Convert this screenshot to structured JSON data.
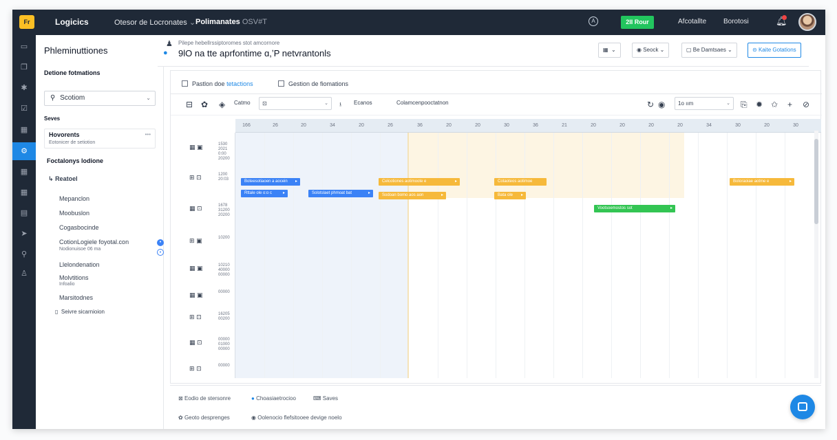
{
  "topbar": {
    "logo": "Fr",
    "brand": "Logicics",
    "menu1": "Otesor de Locronates",
    "menu2": "Polimanates",
    "menu2_sub": "OSV#T",
    "green_button": "2II Rour",
    "link1": "Afcotallte",
    "link2": "Borotosi"
  },
  "sidebar": {
    "title": "Phleminuttiones",
    "section1": "Detione fotmations",
    "select_value": "Scotiom",
    "section2": "Seves",
    "card_title": "Hovorents",
    "card_sub": "Eotonicer de setiotion",
    "section3": "Foctalonys lodione",
    "group": "Reatoel",
    "items": [
      {
        "label": "Mepanclon"
      },
      {
        "label": "Moobuslon"
      },
      {
        "label": "Cogasbocinde"
      },
      {
        "label": "CotionLogiele foyotal.con",
        "sub": "Nodionuisoe 06 ma"
      },
      {
        "label": "Llelondenation"
      },
      {
        "label": "Molvtitions",
        "sub": "Infoalio"
      },
      {
        "label": "Marsitodnes"
      }
    ],
    "footer_item": "Seivre sicarnioion"
  },
  "header": {
    "breadcrumb": "Pilepe hebellrssiptoromes stot amcornore",
    "title": "9lO na tte aprfontime ɑ,ʼP netvrantonls",
    "btn1": "Seock",
    "btn2": "Be Damtsaes",
    "btn_primary": "Kaite Gotations"
  },
  "panel": {
    "tab1_prefix": "Pastlon doe",
    "tab1_highlight": "tetactions",
    "tab2": "Gestion de fiomations",
    "tool_label1": "Catmo",
    "tool_label2": "Ecanos",
    "tool_label3": "Colamcenpooctatnon",
    "zoom_value": "1o ıım"
  },
  "timeline": {
    "dates": [
      "166",
      "26",
      "20",
      "34",
      "20",
      "26",
      "36",
      "20",
      "20",
      "30",
      "36",
      "21",
      "20",
      "20",
      "20",
      "20",
      "34",
      "30",
      "20",
      "30"
    ],
    "rows": [
      {
        "date": "1530 2021 0:00 20200"
      },
      {
        "date": "1200 20:03"
      },
      {
        "date": "1678 31200 20200"
      },
      {
        "date": "10200"
      },
      {
        "date": "10210 40000 00000"
      },
      {
        "date": "00000"
      },
      {
        "date": "16205 00200"
      },
      {
        "date": "00000 01000 00000"
      },
      {
        "date": "00000"
      }
    ],
    "events": [
      {
        "label": "Boteesotiaoen a aocein"
      },
      {
        "label": "Rttale ole o:o c"
      },
      {
        "label": "Solotslaet phmoat bat"
      },
      {
        "label": "Celcotiones aotimoote e"
      },
      {
        "label": "Sodoan bomo aos aon"
      },
      {
        "label": "Cotaoteos aotimoe"
      },
      {
        "label": "Bata ole"
      },
      {
        "label": "Botoraoiae aotme e"
      },
      {
        "label": "Vootsoemostos sot"
      }
    ]
  },
  "footer": {
    "item1": "Eodio de stersonre",
    "item2": "Choasiaetrocioo",
    "item3": "Saves",
    "item4": "Geoto desprenges",
    "item5": "Oolenocio flefsitooee devige noelo"
  }
}
